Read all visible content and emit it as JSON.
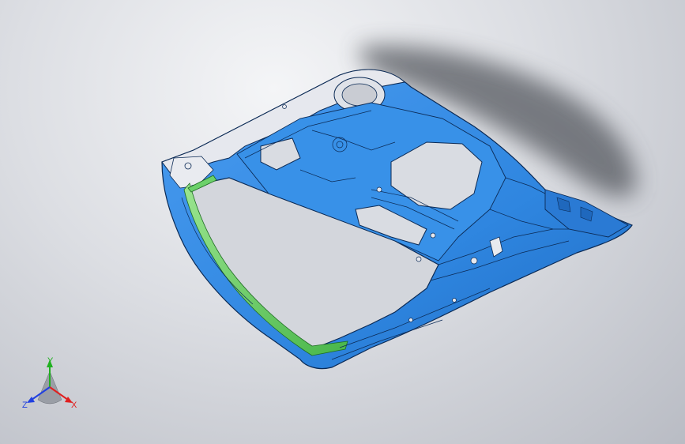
{
  "viewport": {
    "background_colors": {
      "top": "#f4f5f7",
      "bottom": "#b9bcc4"
    }
  },
  "model": {
    "part_color": "#2f86e0",
    "part_highlight": "#5aa8f2",
    "part_shadow": "#1d5fb0",
    "edge_color": "#0b2a55",
    "unpainted_color": "#e6e8ee",
    "selected_strip_color": "#6cd16a",
    "shadow_color": "#5e6169"
  },
  "triad": {
    "x_label": "X",
    "y_label": "Y",
    "z_label": "Z",
    "x_color": "#e02020",
    "y_color": "#20b020",
    "z_color": "#2040e0"
  }
}
